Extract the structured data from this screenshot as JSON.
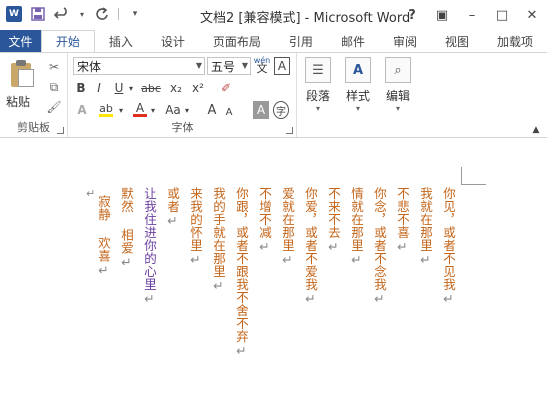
{
  "app": {
    "title": "文档2 [兼容模式] - Microsoft Word",
    "logo_text": "W"
  },
  "window_controls": [
    "?",
    "▣",
    "–",
    "□",
    "✕"
  ],
  "tabs": {
    "file": "文件",
    "items": [
      "开始",
      "插入",
      "设计",
      "页面布局",
      "引用",
      "邮件",
      "审阅",
      "视图",
      "加载项"
    ]
  },
  "ribbon": {
    "clipboard": {
      "paste": "粘贴",
      "label": "剪贴板"
    },
    "font": {
      "label": "字体",
      "font_name": "宋体",
      "font_size": "五号",
      "wen_icon": "wén",
      "A_box": "A",
      "bold": "B",
      "italic": "I",
      "underline": "U",
      "strike": "abc",
      "sub": "x₂",
      "sup": "x²",
      "highlight": "ab",
      "font_color": "A",
      "change_case": "Aa",
      "grow": "A",
      "shrink": "A",
      "char_shade": "A",
      "enclose": "字"
    },
    "paragraph": {
      "label": "段落"
    },
    "styles": {
      "label": "样式"
    },
    "editing": {
      "label": "编辑"
    }
  },
  "document": {
    "columns": [
      {
        "text": "你见，或者不见我",
        "mark": "↵"
      },
      {
        "text": "我就在那里",
        "mark": "↵"
      },
      {
        "text": "不悲不喜",
        "mark": "↵"
      },
      {
        "text": "你念，或者不念我",
        "mark": "↵"
      },
      {
        "text": "情就在那里",
        "mark": "↵"
      },
      {
        "text": "不来不去",
        "mark": "↵"
      },
      {
        "text": "你爱，或者不爱我",
        "mark": "↵"
      },
      {
        "text": "爱就在那里",
        "mark": "↵"
      },
      {
        "text": "不增不减",
        "mark": "↵"
      },
      {
        "text": "你跟，或者不跟我不舍不弃",
        "mark": "↵"
      },
      {
        "text": "我的手就在那里",
        "mark": "↵"
      },
      {
        "text": "来我的怀里",
        "mark": "↵"
      },
      {
        "text": "或者",
        "mark": "↵"
      },
      {
        "text": "让我住进你的心里",
        "mark": "↵"
      },
      {
        "text": "默然 相爱",
        "mark": "↵"
      },
      {
        "text": "寂静 欢喜",
        "mark": "↵"
      }
    ],
    "empty_mark": "↵"
  }
}
